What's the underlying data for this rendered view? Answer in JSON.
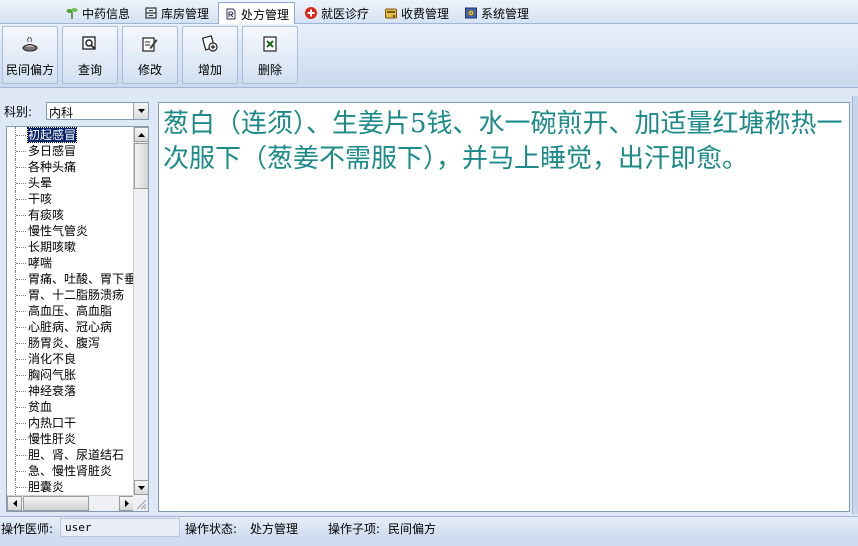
{
  "menu": {
    "tabs": [
      {
        "label": "中药信息",
        "icon": "herb-icon",
        "active": false
      },
      {
        "label": "库房管理",
        "icon": "warehouse-icon",
        "active": false
      },
      {
        "label": "处方管理",
        "icon": "prescription-icon",
        "active": true
      },
      {
        "label": "就医诊疗",
        "icon": "medical-cross-icon",
        "active": false
      },
      {
        "label": "收费管理",
        "icon": "billing-icon",
        "active": false
      },
      {
        "label": "系统管理",
        "icon": "settings-icon",
        "active": false
      }
    ]
  },
  "toolbar": {
    "buttons": [
      {
        "label": "民间偏方",
        "icon": "folk-remedy-icon"
      },
      {
        "label": "查询",
        "icon": "search-icon"
      },
      {
        "label": "修改",
        "icon": "edit-icon"
      },
      {
        "label": "增加",
        "icon": "add-icon"
      },
      {
        "label": "删除",
        "icon": "delete-icon"
      }
    ]
  },
  "sidebar": {
    "category_label": "科别:",
    "category_value": "内科",
    "items": [
      "初起感冒",
      "多日感冒",
      "各种头痛",
      "头晕",
      "干咳",
      "有痰咳",
      "慢性气管炎",
      "长期咳嗽",
      "哮喘",
      "胃痛、吐酸、胃下垂",
      "胃、十二脂肠溃疡",
      "高血压、高血脂",
      "心脏病、冠心病",
      "肠胃炎、腹泻",
      "消化不良",
      "胸闷气胀",
      "神经衰落",
      "贫血",
      "内热口干",
      "慢性肝炎",
      "胆、肾、尿道结石",
      "急、慢性肾脏炎",
      "胆囊炎"
    ],
    "selected_index": 0
  },
  "content": {
    "text": "葱白（连须）、生姜片5钱、水一碗煎开、加适量红塘称热一次服下（葱姜不需服下），并马上睡觉，出汗即愈。",
    "color": "#1d8a8a"
  },
  "status": {
    "doctor_label": "操作医师:",
    "doctor_value": "user",
    "state_label": "操作状态:",
    "state_value": "处方管理",
    "subitem_label": "操作子项:",
    "subitem_value": "民间偏方"
  }
}
